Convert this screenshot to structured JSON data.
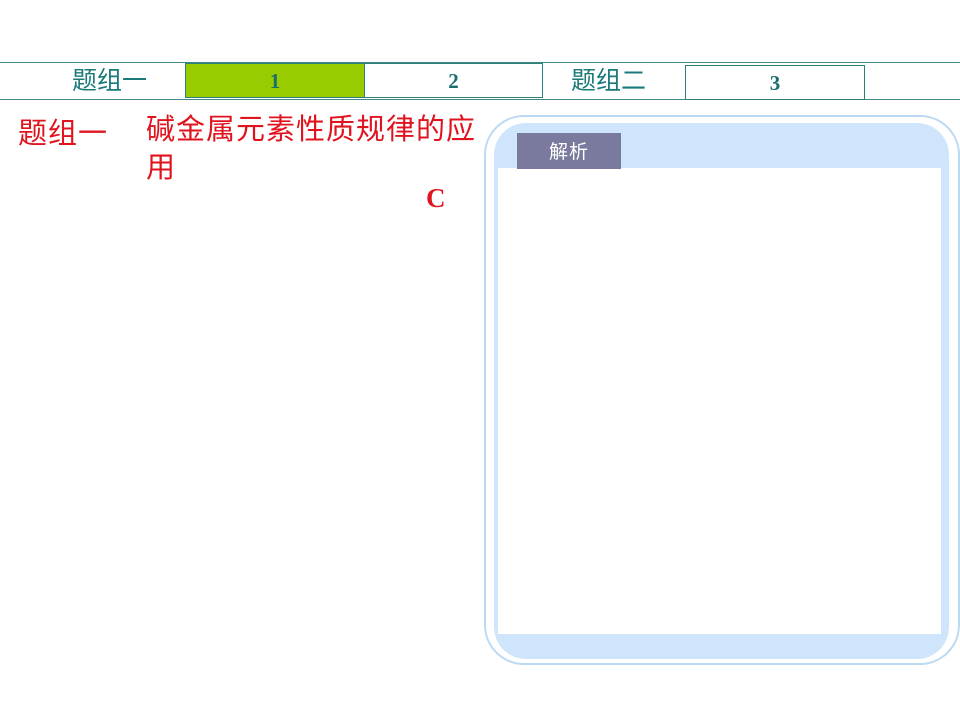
{
  "nav": {
    "group1_label": "题组一",
    "group2_label": "题组二",
    "tabs": [
      {
        "label": "1",
        "active": true
      },
      {
        "label": "2",
        "active": false
      },
      {
        "label": "3",
        "active": false
      }
    ]
  },
  "question": {
    "group_prefix": "题组一",
    "title": "碱金属元素性质规律的应用",
    "answer": "C"
  },
  "analysis": {
    "tab_label": "解析"
  },
  "colors": {
    "accent_red": "#e0141e",
    "teal": "#1a7a7a",
    "active_tab": "#99cc00",
    "panel_blue": "#cfe5fb",
    "panel_tab": "#7a7a9e"
  }
}
